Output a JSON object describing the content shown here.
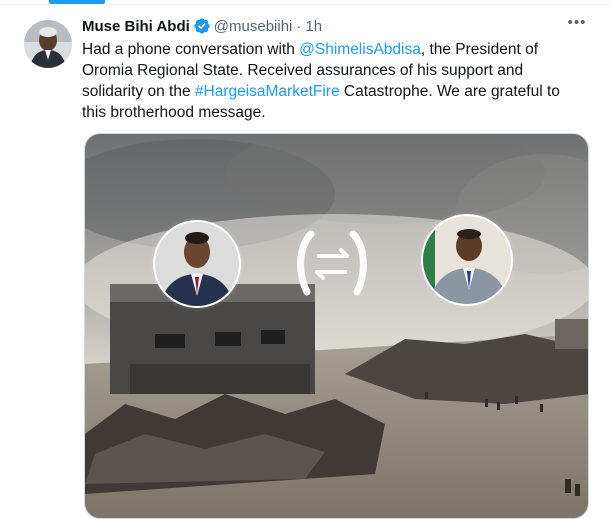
{
  "tweet": {
    "author_name": "Muse Bihi Abdi",
    "handle": "@musebiihi",
    "separator": "·",
    "time": "1h",
    "more_label": "•••",
    "text_part1": "Had a phone conversation with ",
    "mention": "@ShimelisAbdisa",
    "text_part2": ", the President of Oromia Regional State. Received assurances of his support and solidarity on the ",
    "hashtag": "#HargeisaMarketFire",
    "text_part3": " Catastrophe. We are grateful to this brotherhood message."
  },
  "colors": {
    "accent": "#1d9bf0",
    "text_primary": "#0f1419",
    "text_secondary": "#536471"
  },
  "icons": {
    "verified": "verified-badge-icon",
    "more": "more-options-icon",
    "call": "phone-call-swap-icon"
  }
}
